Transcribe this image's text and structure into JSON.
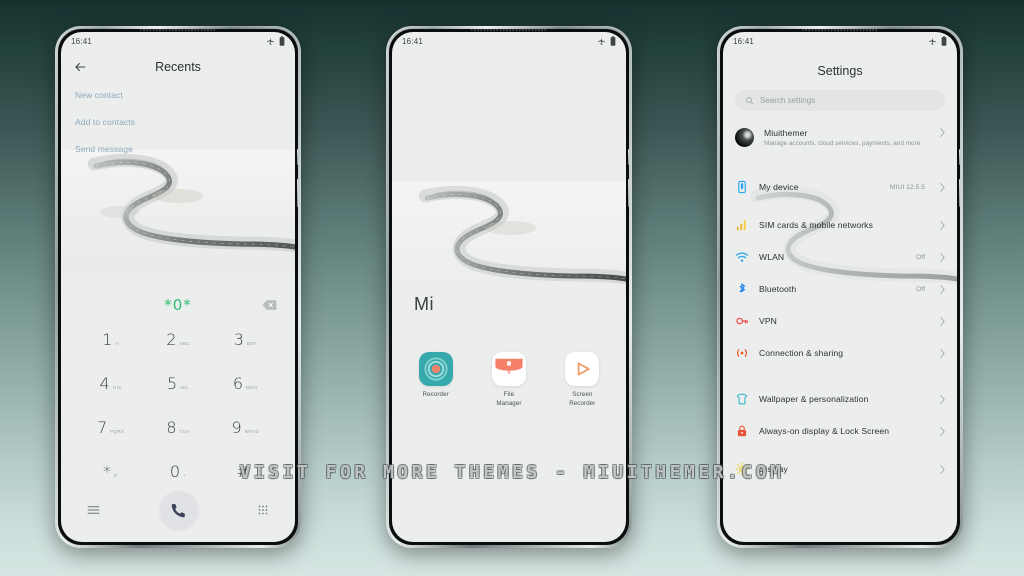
{
  "watermark": "VISIT FOR MORE THEMES - MIUITHEMER.COM",
  "colors": {
    "accent_green": "#2bbd72",
    "link_blue": "#8fa7b8",
    "screen_bg": "#eceeed",
    "text_primary": "#2d3231",
    "text_secondary": "#8d9493",
    "wlan_blue": "#2da7e8",
    "bluetooth_blue": "#1f86e8",
    "vpn_red": "#ef4a4a",
    "sharing_orange": "#f05a28",
    "wallpaper_cyan": "#34b8c4",
    "display_yellow": "#f2d23a"
  },
  "status_bar": {
    "time": "16:41",
    "icons": [
      {
        "name": "airplane-mode-icon"
      },
      {
        "name": "battery-icon"
      }
    ]
  },
  "phone1": {
    "screen_name": "dialer-recents",
    "back_icon": "back-arrow-icon",
    "title": "Recents",
    "quick_actions": [
      {
        "label": "New contact"
      },
      {
        "label": "Add to contacts"
      },
      {
        "label": "Send message"
      }
    ],
    "dial_display": {
      "number": "*0*",
      "backspace_icon": "backspace-icon"
    },
    "keypad": [
      {
        "digit": "1",
        "letters": "∞"
      },
      {
        "digit": "2",
        "letters": "ABC"
      },
      {
        "digit": "3",
        "letters": "DEF"
      },
      {
        "digit": "4",
        "letters": "GHI"
      },
      {
        "digit": "5",
        "letters": "JKL"
      },
      {
        "digit": "6",
        "letters": "MNO"
      },
      {
        "digit": "7",
        "letters": "PQRS"
      },
      {
        "digit": "8",
        "letters": "TUV"
      },
      {
        "digit": "9",
        "letters": "WXYZ"
      },
      {
        "digit": "*",
        "letters": "P,"
      },
      {
        "digit": "0",
        "letters": "+"
      },
      {
        "digit": "#",
        "letters": ";"
      }
    ],
    "bottom_bar": {
      "menu_icon": "hamburger-menu-icon",
      "call_icon": "phone-call-icon",
      "dialpad_icon": "dialpad-grid-icon"
    }
  },
  "phone2": {
    "screen_name": "home-screen",
    "folder_label": "Mi",
    "apps": [
      {
        "name": "Recorder",
        "icon": "recorder-app-icon"
      },
      {
        "name": "File\nManager",
        "icon": "file-manager-app-icon"
      },
      {
        "name": "Screen\nRecorder",
        "icon": "screen-recorder-app-icon"
      }
    ]
  },
  "phone3": {
    "screen_name": "settings",
    "title": "Settings",
    "search": {
      "placeholder": "Search settings",
      "icon": "search-icon"
    },
    "account": {
      "name": "Miuithemer",
      "subtitle": "Manage accounts, cloud services, payments, and more",
      "avatar": "account-avatar"
    },
    "items": [
      {
        "label": "My device",
        "value": "MIUI 12.5.5",
        "icon": "device-icon"
      },
      {
        "label": "SIM cards & mobile networks",
        "value": "",
        "icon": "signal-bars-icon"
      },
      {
        "label": "WLAN",
        "value": "Off",
        "icon": "wifi-icon"
      },
      {
        "label": "Bluetooth",
        "value": "Off",
        "icon": "bluetooth-icon"
      },
      {
        "label": "VPN",
        "value": "",
        "icon": "key-icon"
      },
      {
        "label": "Connection & sharing",
        "value": "",
        "icon": "connection-sharing-icon"
      },
      {
        "label": "Wallpaper & personalization",
        "value": "",
        "icon": "wallpaper-icon"
      },
      {
        "label": "Always-on display & Lock Screen",
        "value": "",
        "icon": "lock-screen-icon"
      },
      {
        "label": "Display",
        "value": "",
        "icon": "display-brightness-icon"
      }
    ]
  }
}
